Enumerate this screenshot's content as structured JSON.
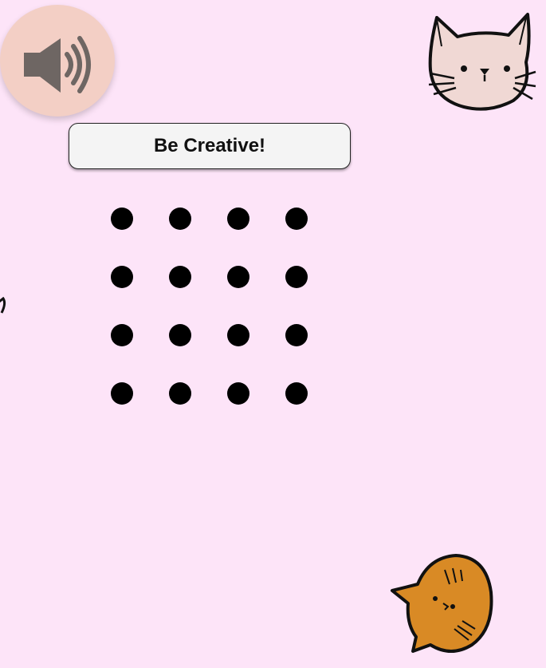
{
  "sound": {
    "icon": "speaker-icon"
  },
  "prompt": {
    "label": "Be Creative!"
  },
  "board": {
    "rows": 4,
    "cols": 4
  },
  "decorations": [
    "cat-face-icon",
    "orange-cat-face-icon"
  ],
  "colors": {
    "background": "#fde4f8",
    "sound_button": "#f3cfc5",
    "dot": "#000000",
    "cat_light": "#f0d8d4",
    "cat_orange": "#d98a25"
  }
}
